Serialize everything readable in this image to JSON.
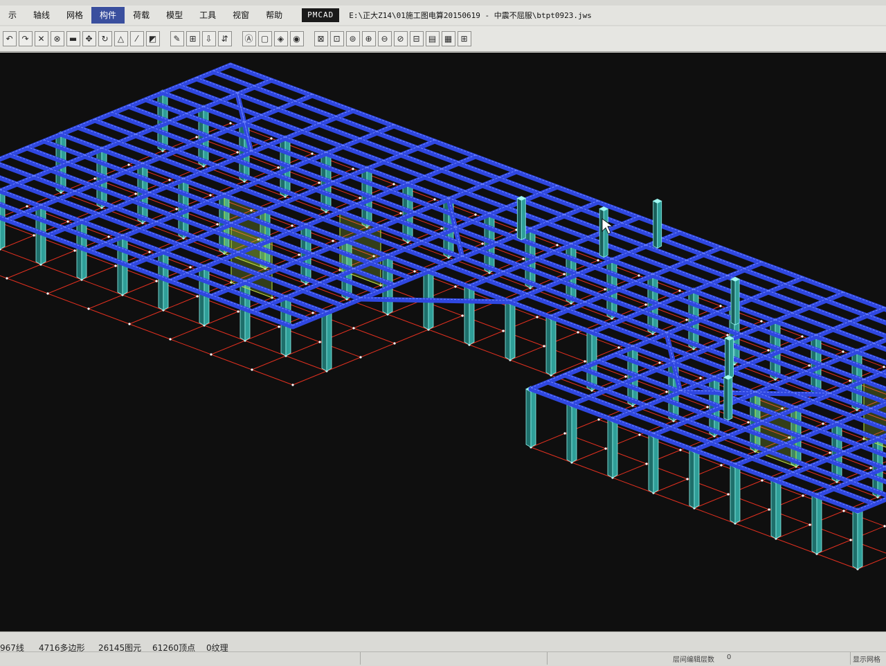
{
  "menu": {
    "items": [
      {
        "label": "示"
      },
      {
        "label": "轴线"
      },
      {
        "label": "网格"
      },
      {
        "label": "构件",
        "active": true
      },
      {
        "label": "荷载"
      },
      {
        "label": "模型"
      },
      {
        "label": "工具"
      },
      {
        "label": "视窗"
      },
      {
        "label": "帮助"
      }
    ],
    "app_tag": "PMCAD",
    "file_path": "E:\\正大Z14\\01施工图电算20150619 - 中震不屈服\\btpt0923.jws"
  },
  "toolbar": {
    "groups": [
      [
        {
          "glyph": "↶"
        },
        {
          "glyph": "↷"
        },
        {
          "glyph": "✕"
        },
        {
          "glyph": "⊗"
        },
        {
          "glyph": "▬"
        },
        {
          "glyph": "✥"
        },
        {
          "glyph": "↻"
        },
        {
          "glyph": "△"
        },
        {
          "glyph": "⁄"
        },
        {
          "glyph": "◩"
        }
      ],
      [
        {
          "glyph": "✎"
        },
        {
          "glyph": "⊞"
        },
        {
          "glyph": "⇩"
        },
        {
          "glyph": "⇵"
        }
      ],
      [
        {
          "glyph": "Ⓐ"
        },
        {
          "glyph": "▢"
        },
        {
          "glyph": "◈"
        },
        {
          "glyph": "◉"
        }
      ],
      [
        {
          "glyph": "⊠"
        },
        {
          "glyph": "⊡"
        },
        {
          "glyph": "⊚"
        },
        {
          "glyph": "⊕"
        },
        {
          "glyph": "⊖"
        },
        {
          "glyph": "⊘"
        },
        {
          "glyph": "⊟"
        },
        {
          "glyph": "▤"
        },
        {
          "glyph": "▦"
        },
        {
          "glyph": "⊞"
        }
      ]
    ]
  },
  "status": {
    "lines": "967线",
    "polygons": "4716多边形",
    "elements": "26145图元",
    "vertices": "61260顶点",
    "textures": "0纹理",
    "layer_label": "层间编辑层数",
    "layer_value": "0",
    "display_label": "显示网格"
  },
  "colors": {
    "beam": "#2f47e0",
    "beam_edge": "#6f86ff",
    "column_fill": "#2f9e98",
    "column_edge": "#8ef2ec",
    "slab_mesh": "#e2301f",
    "slab_node": "#ffffff",
    "wall": "#b6e844",
    "background": "#0f0f0f"
  }
}
